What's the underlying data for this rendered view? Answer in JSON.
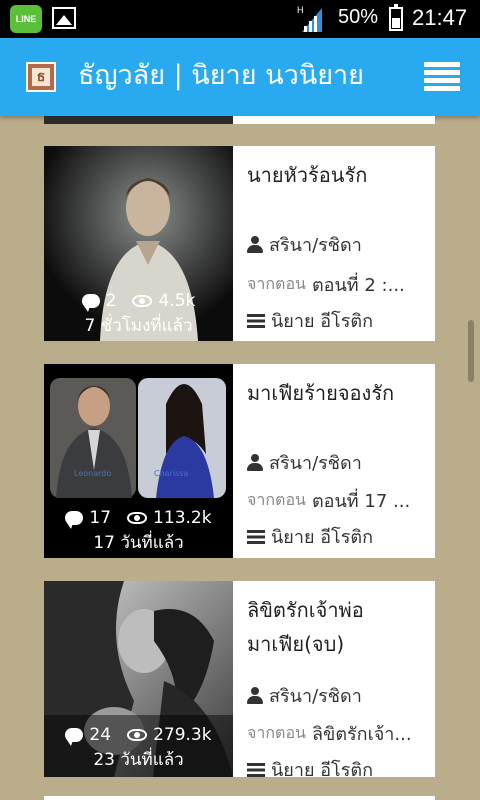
{
  "status_bar": {
    "line_label": "LINE",
    "battery": "50%",
    "time": "21:47",
    "icons": [
      "line-app-icon",
      "gallery-icon",
      "signal-icon",
      "battery-icon"
    ]
  },
  "app_bar": {
    "title": "ธัญวลัย | นิยาย นวนิยาย",
    "logo_letter": "ธ",
    "color": "#29a9f0"
  },
  "stories": [
    {
      "title": "นายหัวร้อนรัก",
      "author": "สรินา/รชิดา",
      "from_label": "จากตอน",
      "chapter": "ตอนที่ 2 :...",
      "category": "นิยาย อีโรติก",
      "comments": "2",
      "views": "4.5k",
      "updated": "7 ชั่วโมงที่แล้ว"
    },
    {
      "title": "มาเฟียร้ายจองรัก",
      "author": "สรินา/รชิดา",
      "from_label": "จากตอน",
      "chapter": "ตอนที่ 17 ...",
      "category": "นิยาย อีโรติก",
      "comments": "17",
      "views": "113.2k",
      "updated": "17 วันที่แล้ว",
      "cover_names": [
        "Leonardo",
        "Charissa"
      ]
    },
    {
      "title": "ลิขิตรักเจ้าพ่อมาเฟีย(จบ)",
      "author": "สรินา/รชิดา",
      "from_label": "จากตอน",
      "chapter": "ลิขิตรักเจ้า...",
      "category": "นิยาย อีโรติก",
      "comments": "24",
      "views": "279.3k",
      "updated": "23 วันที่แล้ว"
    }
  ]
}
